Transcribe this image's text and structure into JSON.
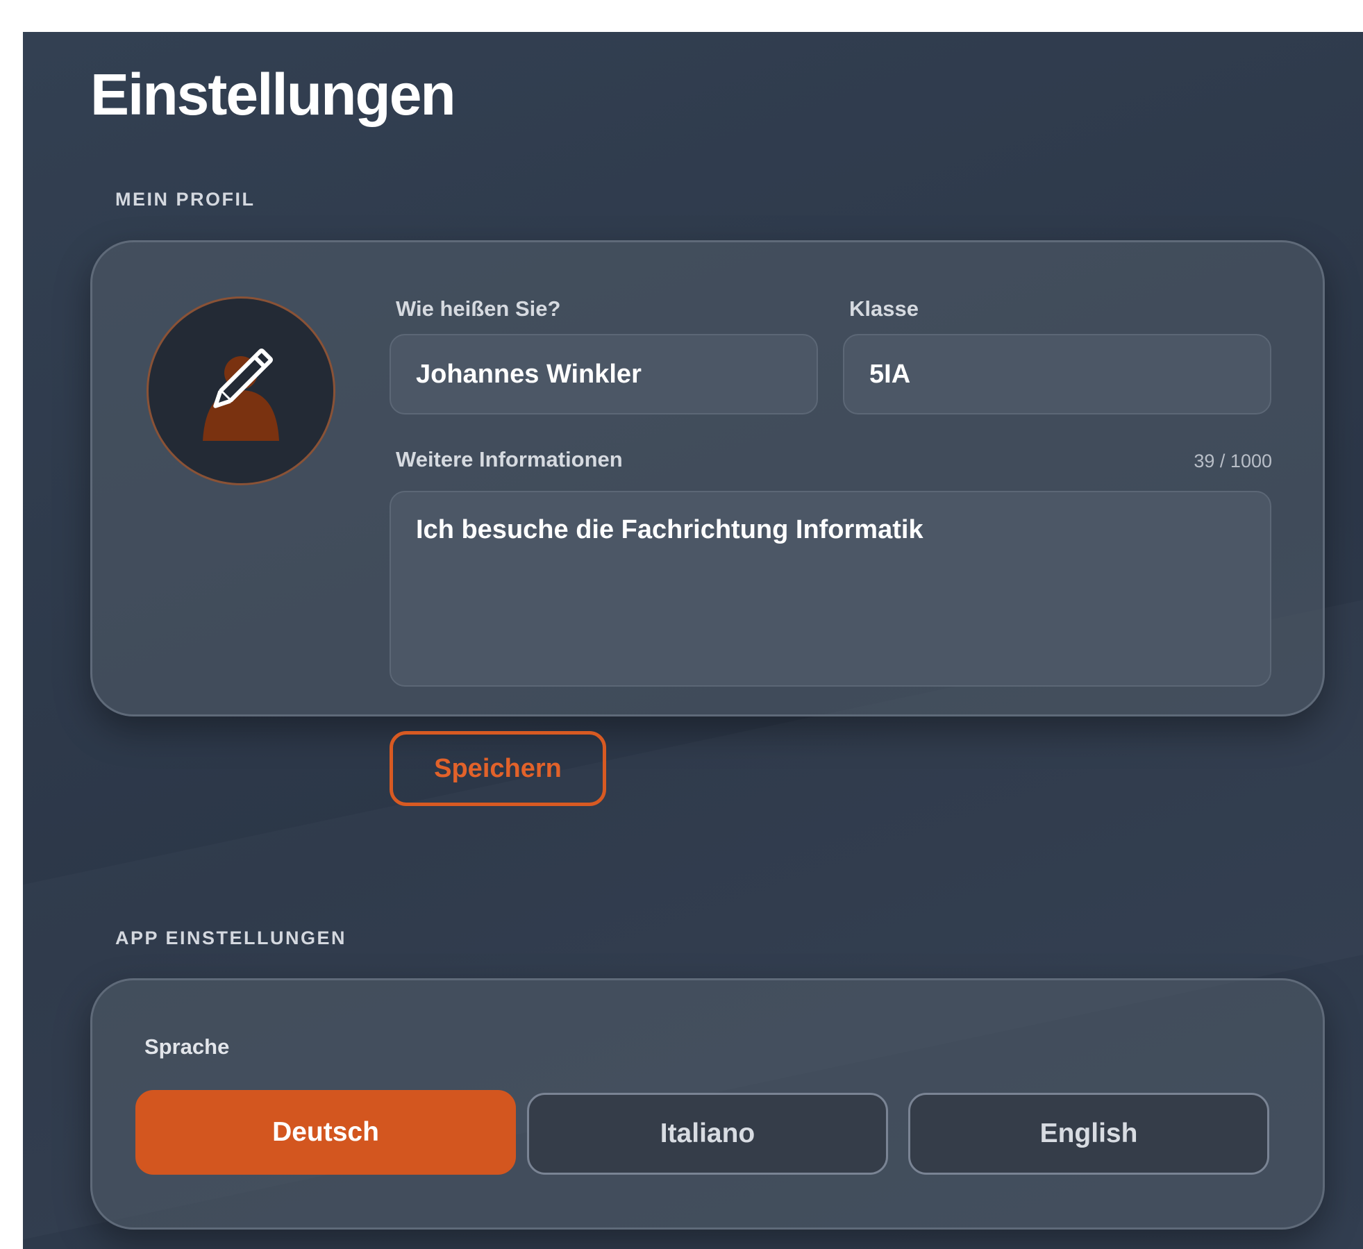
{
  "page": {
    "title": "Einstellungen"
  },
  "profile_section": {
    "heading": "MEIN PROFIL",
    "avatar_icon": "edit-avatar-icon",
    "name_label": "Wie heißen Sie?",
    "name_value": "Johannes Winkler",
    "class_label": "Klasse",
    "class_value": "5IA",
    "info_label": "Weitere Informationen",
    "info_counter": "39 / 1000",
    "info_value": "Ich besuche die Fachrichtung Informatik",
    "save_label": "Speichern"
  },
  "app_section": {
    "heading": "APP EINSTELLUNGEN",
    "language_label": "Sprache",
    "languages": [
      {
        "label": "Deutsch",
        "selected": true
      },
      {
        "label": "Italiano",
        "selected": false
      },
      {
        "label": "English",
        "selected": false
      }
    ]
  },
  "colors": {
    "accent": "#d3561f",
    "background": "#2f3a4b",
    "card": "#48525f"
  }
}
